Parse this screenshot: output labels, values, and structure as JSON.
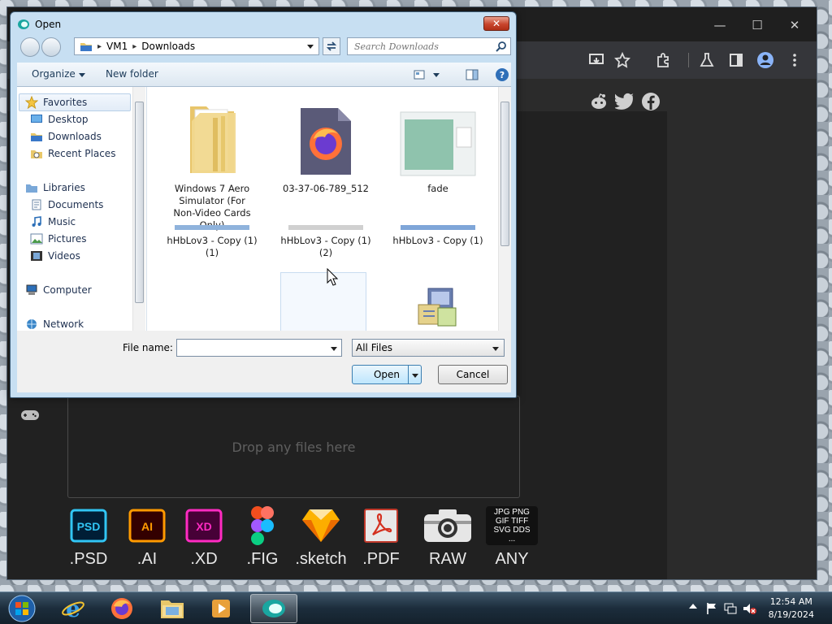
{
  "dialog": {
    "title": "Open",
    "close_label": "✕",
    "breadcrumb": [
      "VM1",
      "Downloads"
    ],
    "search_placeholder": "Search Downloads",
    "commands": {
      "organize": "Organize",
      "new_folder": "New folder"
    },
    "nav": {
      "favorites": "Favorites",
      "favorites_items": [
        "Desktop",
        "Downloads",
        "Recent Places"
      ],
      "libraries": "Libraries",
      "libraries_items": [
        "Documents",
        "Music",
        "Pictures",
        "Videos"
      ],
      "computer": "Computer",
      "network": "Network"
    },
    "files": [
      {
        "name": "Windows 7 Aero Simulator (For Non-Video Cards Only)"
      },
      {
        "name": "03-37-06-789_512"
      },
      {
        "name": "fade"
      },
      {
        "name": "hHbLov3 - Copy (1) (1)"
      },
      {
        "name": "hHbLov3 - Copy (1) (2)"
      },
      {
        "name": "hHbLov3 - Copy (1)"
      }
    ],
    "file_name_label": "File name:",
    "file_name_value": "",
    "file_type": "All Files",
    "open_label": "Open",
    "cancel_label": "Cancel"
  },
  "page": {
    "drop_text": "Drop any files here",
    "formats": [
      {
        "label": ".PSD",
        "icon": "psd-icon",
        "color": "#31c5f4",
        "badge": "PSD"
      },
      {
        "label": ".AI",
        "icon": "ai-icon",
        "color": "#ff9a00",
        "badge": "AI"
      },
      {
        "label": ".XD",
        "icon": "xd-icon",
        "color": "#ff2bc2",
        "badge": "XD"
      },
      {
        "label": ".FIG",
        "icon": "figma-icon"
      },
      {
        "label": ".sketch",
        "icon": "sketch-icon"
      },
      {
        "label": ".PDF",
        "icon": "pdf-icon"
      },
      {
        "label": "RAW",
        "icon": "camera-icon"
      },
      {
        "label": "ANY",
        "icon": "any-format-icon",
        "badge_lines": [
          "JPG PNG",
          "GIF TIFF",
          "SVG DDS",
          "..."
        ]
      }
    ]
  },
  "taskbar": {
    "time": "12:54 AM",
    "date": "8/19/2024"
  }
}
